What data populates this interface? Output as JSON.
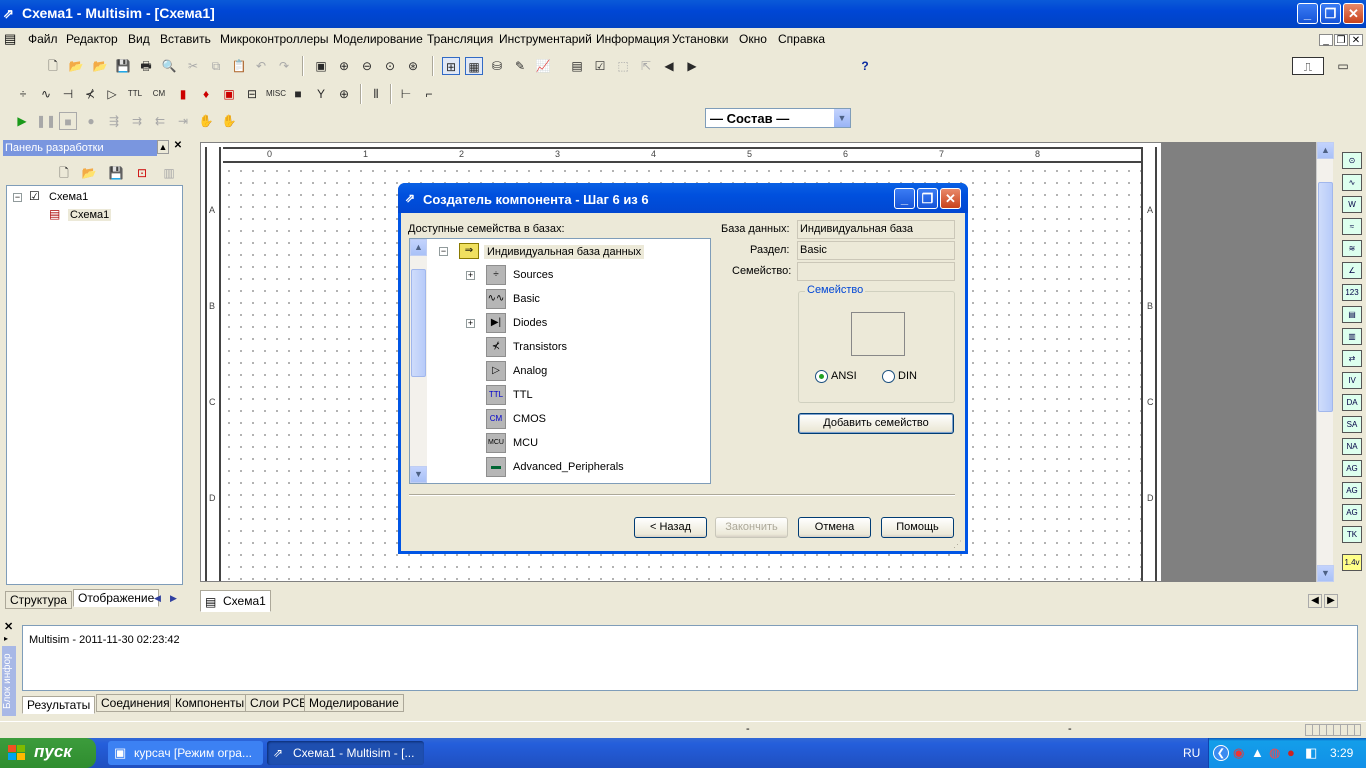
{
  "window": {
    "title": "Схема1 - Multisim - [Схема1]",
    "app_icon": "multisim-icon",
    "minimize": "_",
    "maximize": "❐",
    "close": "✕"
  },
  "menu": {
    "items": [
      "Файл",
      "Редактор",
      "Вид",
      "Вставить",
      "Микроконтроллеры",
      "Моделирование",
      "Трансляция",
      "Инструментарий",
      "Информация",
      "Установки",
      "Окно",
      "Справка"
    ],
    "mdi_min": "_",
    "mdi_restore": "❐",
    "mdi_close": "✕"
  },
  "toolbar": {
    "combo_value": "— Состав —",
    "combo_arrow": "▼",
    "help_icon": "?"
  },
  "left_panel": {
    "title": "Панель разработки",
    "tree": {
      "root": "Схема1",
      "child": "Схема1"
    },
    "tabs": [
      "Структура",
      "Отображение"
    ]
  },
  "workspace": {
    "ruler_top": [
      "0",
      "1",
      "2",
      "3",
      "4",
      "5",
      "6",
      "7",
      "8"
    ],
    "ruler_side": [
      "A",
      "B",
      "C",
      "D"
    ]
  },
  "sheet_tab": {
    "label": "Схема1"
  },
  "bottom_panel": {
    "side_label": "Блок инфор",
    "log_line": "Multisim  -  2011-11-30 02:23:42",
    "tabs": [
      "Результаты",
      "Соединения",
      "Компоненты",
      "Слои PCB",
      "Моделирование"
    ]
  },
  "status": {
    "dash1": "-",
    "dash2": "-"
  },
  "taskbar": {
    "start": "пуск",
    "tasks": [
      "курсач [Режим огра...",
      "Схема1 - Multisim - [..."
    ],
    "lang": "RU",
    "time": "3:29"
  },
  "dialog": {
    "title": "Создатель компонента - Шаг 6 из 6",
    "families_label": "Доступные семейства в базах:",
    "tree_root": "Индивидуальная база данных",
    "tree_items": [
      {
        "label": "Sources",
        "icon": "÷",
        "expander": "+"
      },
      {
        "label": "Basic",
        "icon": "∿∿",
        "expander": ""
      },
      {
        "label": "Diodes",
        "icon": "▶|",
        "expander": "+"
      },
      {
        "label": "Transistors",
        "icon": "⊀",
        "expander": ""
      },
      {
        "label": "Analog",
        "icon": "▷",
        "expander": ""
      },
      {
        "label": "TTL",
        "icon": "TTL",
        "expander": ""
      },
      {
        "label": "CMOS",
        "icon": "CM",
        "expander": ""
      },
      {
        "label": "MCU",
        "icon": "MCU",
        "expander": ""
      },
      {
        "label": "Advanced_Peripherals",
        "icon": "▬",
        "expander": ""
      }
    ],
    "db_label": "База данных:",
    "db_value": "Индивидуальная база данных",
    "section_label": "Раздел:",
    "section_value": "Basic",
    "family_label": "Семейство:",
    "family_value": "",
    "group_title": "Семейство",
    "radio_ansi": "ANSI",
    "radio_din": "DIN",
    "add_family": "Добавить семейство",
    "btn_back": "< Назад",
    "btn_finish": "Закончить",
    "btn_cancel": "Отмена",
    "btn_help": "Помощь"
  },
  "colors": {
    "xp_blue": "#0050de",
    "xp_green": "#3c9c3c",
    "panel": "#ece9d8"
  }
}
